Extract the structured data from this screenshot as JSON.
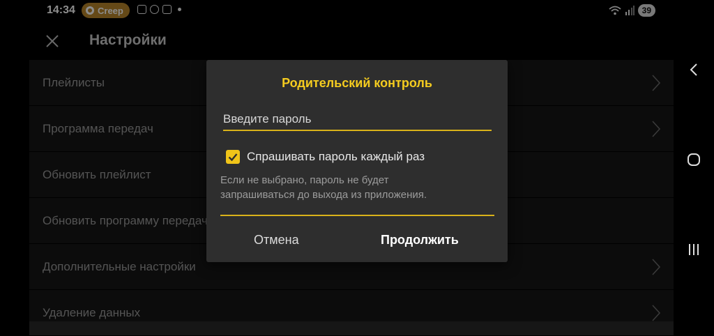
{
  "status_bar": {
    "time": "14:34",
    "app_pill_label": "Creep",
    "battery": "39"
  },
  "app_bar": {
    "title": "Настройки",
    "close_icon": "close-icon"
  },
  "settings_list": [
    {
      "label": "Плейлисты",
      "chevron": true
    },
    {
      "label": "Программа передач",
      "chevron": true
    },
    {
      "label": "Обновить плейлист",
      "chevron": false
    },
    {
      "label": "Обновить программу передач",
      "chevron": false
    },
    {
      "label": "Дополнительные настройки",
      "chevron": true
    },
    {
      "label": "Удаление данных",
      "chevron": true
    }
  ],
  "dialog": {
    "title": "Родительский контроль",
    "password_placeholder": "Введите пароль",
    "checkbox_label": "Спрашивать пароль каждый раз",
    "checkbox_checked": true,
    "hint_line1": "Если не выбрано, пароль не будет",
    "hint_line2": "запрашиваться до выхода из приложения.",
    "cancel_label": "Отмена",
    "continue_label": "Продолжить"
  },
  "colors": {
    "accent": "#f5cc1f",
    "dialog_bg": "#2e2e2e",
    "row_bg": "#161616",
    "pill": "#b8862b"
  }
}
